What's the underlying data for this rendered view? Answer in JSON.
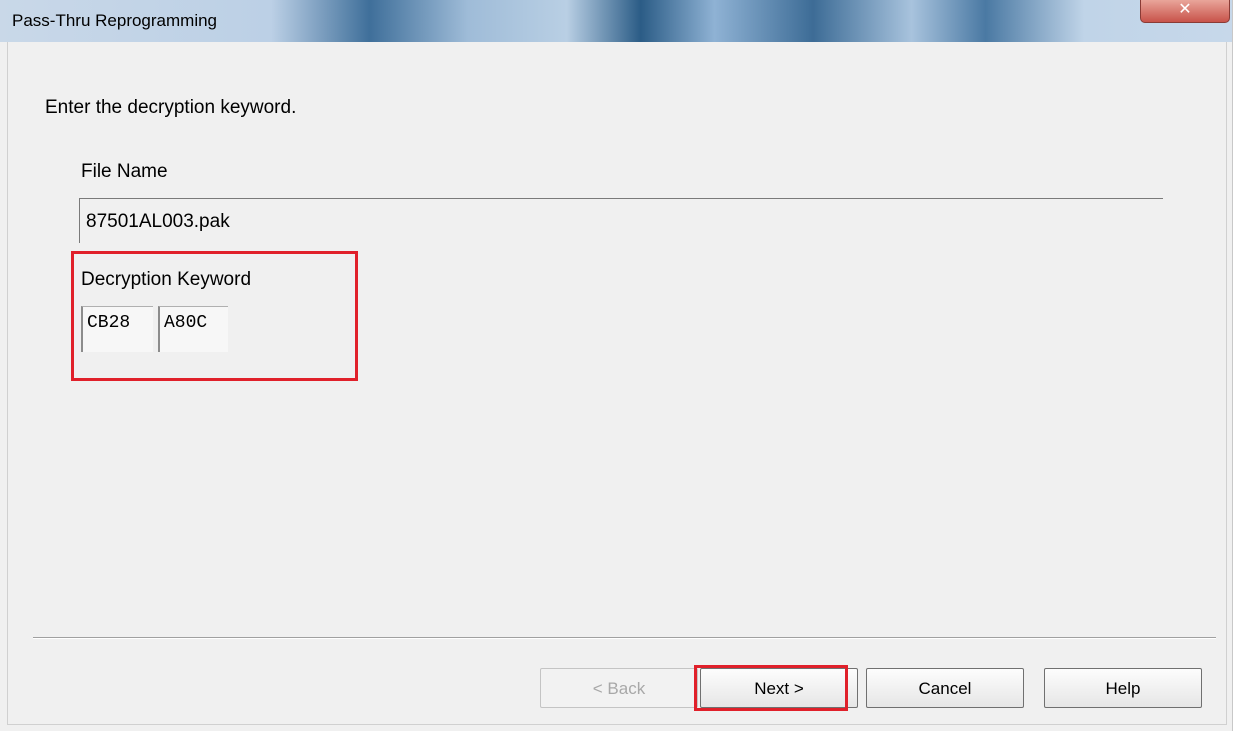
{
  "window": {
    "title": "Pass-Thru Reprogramming",
    "close_glyph": "✕"
  },
  "page": {
    "prompt": "Enter the decryption keyword."
  },
  "file": {
    "label": "File Name",
    "value": "87501AL003.pak"
  },
  "decryption": {
    "label": "Decryption Keyword",
    "part1": "CB28",
    "part2": "A80C"
  },
  "buttons": {
    "back": "< Back",
    "next": "Next >",
    "cancel": "Cancel",
    "help": "Help"
  },
  "colors": {
    "highlight": "#e0202a",
    "dialog_bg": "#f0f0f0"
  }
}
